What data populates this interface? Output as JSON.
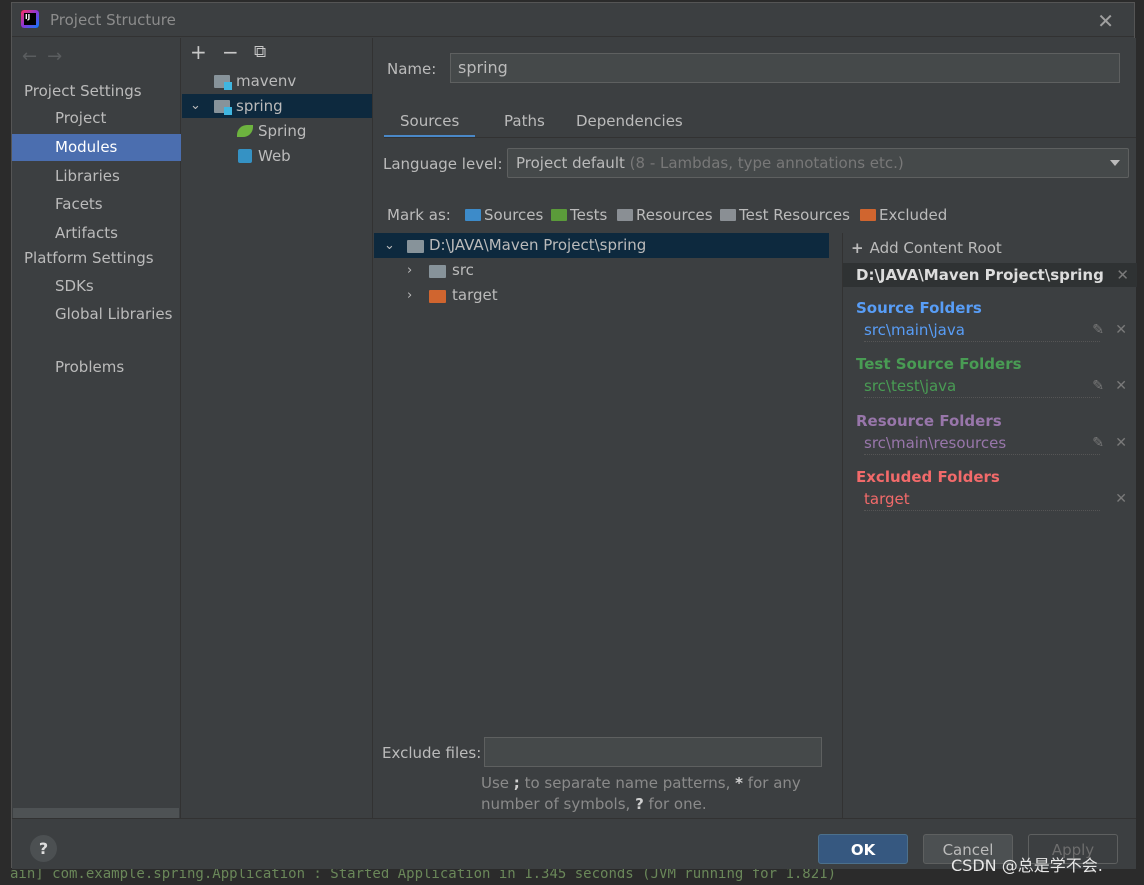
{
  "window": {
    "title": "Project Structure",
    "close": "✕"
  },
  "sidebar": {
    "sections": [
      {
        "label": "Project Settings",
        "items": [
          "Project",
          "Modules",
          "Libraries",
          "Facets",
          "Artifacts"
        ]
      },
      {
        "label": "Platform Settings",
        "items": [
          "SDKs",
          "Global Libraries"
        ]
      }
    ],
    "problems": "Problems",
    "selected": "Modules"
  },
  "modules": {
    "toolbar": {
      "add": "+",
      "remove": "−",
      "copy": "⧉"
    },
    "tree": [
      {
        "label": "mavenv",
        "icon": "module-folder-icon"
      },
      {
        "label": "spring",
        "icon": "module-folder-icon",
        "expanded": true,
        "selected": true
      },
      {
        "label": "Spring",
        "icon": "spring-leaf-icon"
      },
      {
        "label": "Web",
        "icon": "web-icon"
      }
    ]
  },
  "details": {
    "name_label": "Name:",
    "name_value": "spring",
    "tabs": [
      "Sources",
      "Paths",
      "Dependencies"
    ],
    "active_tab": "Sources",
    "language_level_label": "Language level:",
    "language_level_value": "Project default",
    "language_level_hint": "(8 - Lambdas, type annotations etc.)",
    "mark_as_label": "Mark as:",
    "mark_as": [
      {
        "label": "Sources",
        "color": "#3d8bc9"
      },
      {
        "label": "Tests",
        "color": "#5b9b3a"
      },
      {
        "label": "Resources",
        "color": "#8a8f94"
      },
      {
        "label": "Test Resources",
        "color": "#8a8f94"
      },
      {
        "label": "Excluded",
        "color": "#d0652f"
      }
    ],
    "content_tree": [
      {
        "label": "D:\\JAVA\\Maven Project\\spring",
        "expanded": true,
        "color": "#87939a"
      },
      {
        "label": "src",
        "color": "#87939a"
      },
      {
        "label": "target",
        "color": "#d0652f"
      }
    ],
    "add_content_root": "Add Content Root",
    "root_path": "D:\\JAVA\\Maven Project\\spring",
    "folder_groups": [
      {
        "title": "Source Folders",
        "path": "src\\main\\java",
        "title_color": "#589df6",
        "path_color": "#589df6",
        "editable": true
      },
      {
        "title": "Test Source Folders",
        "path": "src\\test\\java",
        "title_color": "#499c54",
        "path_color": "#499c54",
        "editable": true
      },
      {
        "title": "Resource Folders",
        "path": "src\\main\\resources",
        "title_color": "#9876aa",
        "path_color": "#9876aa",
        "editable": true
      },
      {
        "title": "Excluded Folders",
        "path": "target",
        "title_color": "#f26a6a",
        "path_color": "#f26a6a",
        "editable": false
      }
    ],
    "exclude_files_label": "Exclude files:",
    "exclude_files_value": "",
    "hint_parts": [
      "Use ",
      ";",
      " to separate name patterns, ",
      "*",
      " for any number of symbols, ",
      "?",
      " for one."
    ]
  },
  "buttons": {
    "help": "?",
    "ok": "OK",
    "cancel": "Cancel",
    "apply": "Apply"
  },
  "watermark": "CSDN @总是学不会."
}
